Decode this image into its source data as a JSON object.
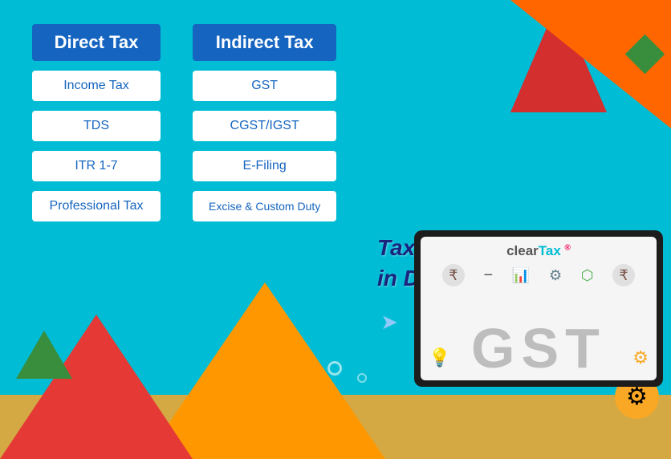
{
  "page": {
    "title": "Taxation Training Course"
  },
  "background": {
    "primary_color": "#00bcd4"
  },
  "direct_tax": {
    "header": "Direct Tax",
    "items": [
      {
        "label": "Income Tax"
      },
      {
        "label": "TDS"
      },
      {
        "label": "ITR 1-7"
      },
      {
        "label": "Professional Tax"
      }
    ]
  },
  "indirect_tax": {
    "header": "Indirect Tax",
    "items": [
      {
        "label": "GST"
      },
      {
        "label": "CGST/IGST"
      },
      {
        "label": "E-Filing"
      },
      {
        "label": "Excise & Custom Duty"
      }
    ]
  },
  "tagline": {
    "line1": "Taxation Training Course",
    "line2": "in Delhi, Noida & Gurgaon"
  },
  "laptop": {
    "logo_clear": "clear",
    "logo_tax": "Tax",
    "gst_label": "GST"
  },
  "icons": {
    "arrow": "➤",
    "gear": "⚙",
    "rupee": "₹",
    "bulb": "💡",
    "chart": "📊",
    "settings": "⚙️",
    "network": "🔗"
  }
}
